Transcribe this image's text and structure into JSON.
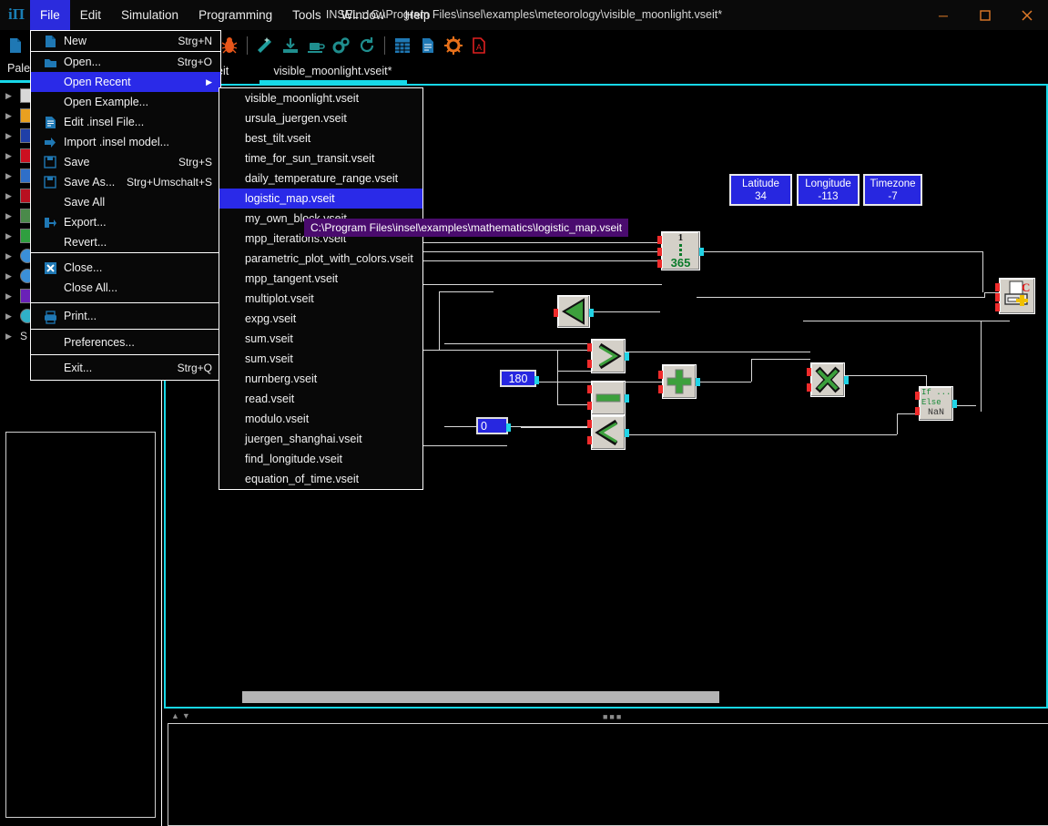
{
  "window": {
    "title": "INSEL :: C:\\Program Files\\insel\\examples\\meteorology\\visible_moonlight.vseit*",
    "app_icon": "insel-logo-icon",
    "minimize": "─",
    "maximize": "□",
    "close": "✕"
  },
  "menubar": {
    "items": [
      {
        "label": "File",
        "active": true
      },
      {
        "label": "Edit",
        "active": false
      },
      {
        "label": "Simulation",
        "active": false
      },
      {
        "label": "Programming",
        "active": false
      },
      {
        "label": "Tools",
        "active": false
      },
      {
        "label": "Window",
        "active": false
      },
      {
        "label": "Help",
        "active": false
      }
    ]
  },
  "toolbar": {
    "items": [
      {
        "name": "new-file-icon"
      },
      {
        "name": "open-folder-icon"
      },
      {
        "name": "save-icon"
      },
      {
        "name": "delete-trash-icon"
      },
      {
        "name": "eraser-icon"
      },
      {
        "name": "separator"
      },
      {
        "name": "run-play-icon"
      },
      {
        "name": "pause-icon"
      },
      {
        "name": "stop-icon"
      },
      {
        "name": "debug-bug-icon"
      },
      {
        "name": "separator"
      },
      {
        "name": "magic-wand-icon"
      },
      {
        "name": "download-icon"
      },
      {
        "name": "coffee-cup-icon"
      },
      {
        "name": "gears-icon"
      },
      {
        "name": "refresh-icon"
      },
      {
        "name": "separator"
      },
      {
        "name": "calculator-icon"
      },
      {
        "name": "document-icon"
      },
      {
        "name": "sun-settings-icon"
      },
      {
        "name": "pdf-icon"
      }
    ]
  },
  "file_menu": {
    "items": [
      {
        "label": "New",
        "accel": "Strg+N",
        "icon": "new-file-icon",
        "type": "item"
      },
      {
        "type": "separator"
      },
      {
        "label": "Open...",
        "accel": "Strg+O",
        "icon": "open-folder-icon",
        "type": "item"
      },
      {
        "label": "Open Recent",
        "accel": "",
        "icon": "",
        "type": "submenu",
        "highlighted": true,
        "arrow": "▶"
      },
      {
        "label": "Open Example...",
        "accel": "",
        "icon": "",
        "type": "item"
      },
      {
        "label": "Edit .insel File...",
        "accel": "",
        "icon": "edit-file-icon",
        "type": "item"
      },
      {
        "label": "Import .insel model...",
        "accel": "",
        "icon": "import-arrow-icon",
        "type": "item"
      },
      {
        "label": "Save",
        "accel": "Strg+S",
        "icon": "save-floppy-icon",
        "type": "item"
      },
      {
        "label": "Save As...",
        "accel": "Strg+Umschalt+S",
        "icon": "save-floppy-icon",
        "type": "item"
      },
      {
        "label": "Save All",
        "accel": "",
        "icon": "",
        "type": "item"
      },
      {
        "label": "Export...",
        "accel": "",
        "icon": "export-arrow-icon",
        "type": "item"
      },
      {
        "label": "Revert...",
        "accel": "",
        "icon": "",
        "type": "item"
      },
      {
        "type": "separator"
      },
      {
        "label": "Close...",
        "accel": "",
        "icon": "close-x-icon",
        "type": "item"
      },
      {
        "label": "Close All...",
        "accel": "",
        "icon": "",
        "type": "item"
      },
      {
        "type": "separator"
      },
      {
        "label": "Print...",
        "accel": "",
        "icon": "printer-icon",
        "type": "item"
      },
      {
        "type": "separator"
      },
      {
        "label": "Preferences...",
        "accel": "",
        "icon": "",
        "type": "item"
      },
      {
        "type": "separator"
      },
      {
        "label": "Exit...",
        "accel": "Strg+Q",
        "icon": "",
        "type": "item"
      }
    ]
  },
  "recent_submenu": {
    "items": [
      {
        "label": "visible_moonlight.vseit",
        "highlighted": false
      },
      {
        "label": "ursula_juergen.vseit",
        "highlighted": false
      },
      {
        "label": "best_tilt.vseit",
        "highlighted": false
      },
      {
        "label": "time_for_sun_transit.vseit",
        "highlighted": false
      },
      {
        "label": "daily_temperature_range.vseit",
        "highlighted": false
      },
      {
        "label": "logistic_map.vseit",
        "highlighted": true
      },
      {
        "label": "my_own_block.vseit",
        "highlighted": false
      },
      {
        "label": "mpp_iterations.vseit",
        "highlighted": false
      },
      {
        "label": "parametric_plot_with_colors.vseit",
        "highlighted": false
      },
      {
        "label": "mpp_tangent.vseit",
        "highlighted": false
      },
      {
        "label": "multiplot.vseit",
        "highlighted": false
      },
      {
        "label": "expg.vseit",
        "highlighted": false
      },
      {
        "label": "sum.vseit",
        "highlighted": false
      },
      {
        "label": "sum.vseit",
        "highlighted": false
      },
      {
        "label": "nurnberg.vseit",
        "highlighted": false
      },
      {
        "label": "read.vseit",
        "highlighted": false
      },
      {
        "label": "modulo.vseit",
        "highlighted": false
      },
      {
        "label": "juergen_shanghai.vseit",
        "highlighted": false
      },
      {
        "label": "find_longitude.vseit",
        "highlighted": false
      },
      {
        "label": "equation_of_time.vseit",
        "highlighted": false
      }
    ]
  },
  "tooltip": {
    "text": "C:\\Program Files\\insel\\examples\\mathematics\\logistic_map.vseit"
  },
  "palette": {
    "title": "Palette",
    "items": [
      {
        "label": "",
        "color": "#d8d8d8",
        "arrow": "▶"
      },
      {
        "label": "",
        "color": "#e8a020",
        "arrow": "▶"
      },
      {
        "label": "",
        "color": "#1f3fa8",
        "arrow": "▶"
      },
      {
        "label": "",
        "color": "#cc1020",
        "arrow": "▶"
      },
      {
        "label": "",
        "color": "#2f6fc8",
        "arrow": "▶"
      },
      {
        "label": "",
        "color": "#b81020",
        "arrow": "▶"
      },
      {
        "label": "",
        "color": "#4a8a4a",
        "arrow": "▶"
      },
      {
        "label": "",
        "color": "#2f9f3f",
        "arrow": "▶"
      },
      {
        "label": "",
        "color": "#3a8fd8",
        "arrow": "▶"
      },
      {
        "label": "",
        "color": "#3a8fd8",
        "arrow": "▶"
      },
      {
        "label": "",
        "color": "#6a21b8",
        "arrow": "▶"
      },
      {
        "label": "",
        "color": "#2fb0c8",
        "arrow": "▶"
      },
      {
        "label": "S",
        "color": "",
        "arrow": "▶"
      }
    ]
  },
  "tabs": {
    "items": [
      {
        "label": "eit",
        "active": false
      },
      {
        "label": "visible_moonlight.vseit*",
        "active": true
      }
    ]
  },
  "diagram": {
    "value_boxes": [
      {
        "name": "latitude-block",
        "title": "Latitude",
        "value": "34"
      },
      {
        "name": "longitude-block",
        "title": "Longitude",
        "value": "-113"
      },
      {
        "name": "timezone-block",
        "title": "Timezone",
        "value": "-7"
      }
    ],
    "constants": [
      {
        "name": "constant-180",
        "value": "180"
      },
      {
        "name": "constant-0",
        "value": "0"
      }
    ],
    "blocks": [
      {
        "name": "do-loop-block",
        "top_label": "1",
        "bottom_label": "365"
      },
      {
        "name": "gain-triangle-block",
        "symbol": "triangle"
      },
      {
        "name": "add-block",
        "symbol": "plus"
      },
      {
        "name": "greater-than-block",
        "symbol": "greater"
      },
      {
        "name": "subtract-block",
        "symbol": "minus"
      },
      {
        "name": "less-than-block",
        "symbol": "less"
      },
      {
        "name": "multiply-block",
        "symbol": "times"
      },
      {
        "name": "if-else-block",
        "line1": "If ...",
        "line2": "Else",
        "line3": "NaN"
      },
      {
        "name": "screen-output-block",
        "symbol": "printer-c"
      }
    ]
  }
}
